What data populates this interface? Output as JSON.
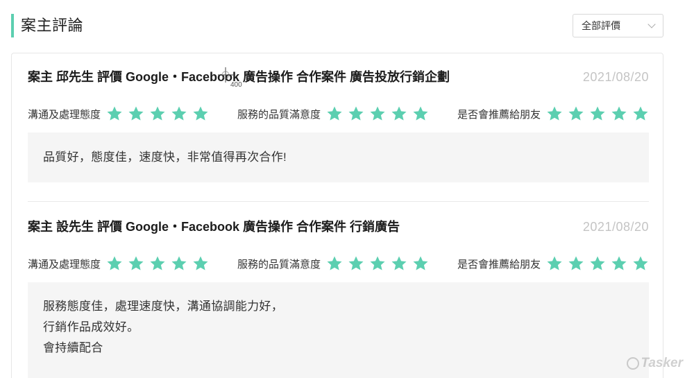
{
  "header": {
    "title": "案主評論",
    "filter_label": "全部評價"
  },
  "reviews": [
    {
      "title": "案主 邱先生 評價 Google・Facebook 廣告操作 合作案件 廣告投放行銷企劃",
      "date": "2021/08/20",
      "ratings": [
        {
          "label": "溝通及處理態度",
          "stars": 5
        },
        {
          "label": "服務的品質滿意度",
          "stars": 5
        },
        {
          "label": "是否會推薦給朋友",
          "stars": 5
        }
      ],
      "comment": [
        "品質好，態度佳，速度快，非常值得再次合作!"
      ]
    },
    {
      "title": "案主 設先生 評價 Google・Facebook 廣告操作 合作案件 行銷廣告",
      "date": "2021/08/20",
      "ratings": [
        {
          "label": "溝通及處理態度",
          "stars": 5
        },
        {
          "label": "服務的品質滿意度",
          "stars": 5
        },
        {
          "label": "是否會推薦給朋友",
          "stars": 5
        }
      ],
      "comment": [
        "服務態度佳，處理速度快，溝通協調能力好，",
        "行銷作品成效好。",
        "會持續配合"
      ]
    }
  ],
  "watermark": "Tasker",
  "cursor_label": "400",
  "colors": {
    "accent": "#5ccfb0",
    "star": "#5ccfb0",
    "date": "#c4c4c4",
    "comment_bg": "#f5f5f5"
  },
  "icons": {
    "star": "star-icon",
    "chevron": "chevron-down-icon",
    "watermark": "tasker-logo-icon"
  }
}
